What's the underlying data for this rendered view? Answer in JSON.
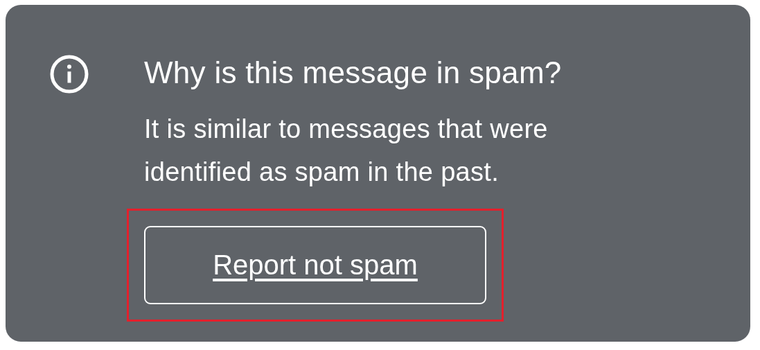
{
  "notice": {
    "title": "Why is this message in spam?",
    "message": "It is similar to messages that were identified as spam in the past.",
    "button": {
      "label": "Report not spam",
      "highlighted": true
    }
  }
}
